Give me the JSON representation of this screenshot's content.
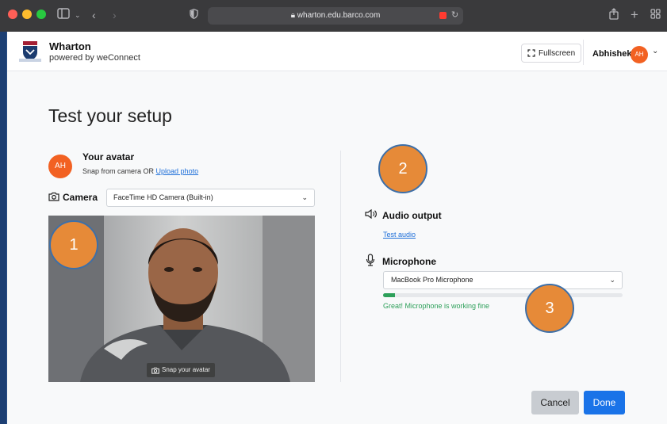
{
  "browser": {
    "url": "wharton.edu.barco.com",
    "icons": [
      "sidebar-icon",
      "back-icon",
      "forward-icon",
      "shield-icon",
      "lock-icon",
      "camera-record-icon",
      "reload-icon",
      "share-icon",
      "new-tab-icon",
      "tab-overview-icon"
    ]
  },
  "header": {
    "brand_name": "Wharton",
    "brand_sub": "powered by weConnect",
    "fullscreen_label": "Fullscreen",
    "user_name": "Abhishek",
    "user_initials": "AH"
  },
  "main": {
    "title": "Test your setup",
    "avatar": {
      "initials": "AH",
      "title": "Your avatar",
      "sub_prefix": "Snap from camera OR ",
      "upload_link": "Upload photo"
    },
    "camera": {
      "label": "Camera",
      "selected": "FaceTime HD Camera (Built-in)",
      "snap_button": "Snap your avatar"
    },
    "audio": {
      "label": "Audio output",
      "test_link": "Test audio"
    },
    "microphone": {
      "label": "Microphone",
      "selected": "MacBook Pro Microphone",
      "level_fraction": 0.05,
      "status": "Great! Microphone is working fine"
    },
    "buttons": {
      "cancel": "Cancel",
      "done": "Done"
    }
  },
  "annotations": [
    "1",
    "2",
    "3"
  ],
  "colors": {
    "accent": "#1a73e8",
    "avatar": "#f26122",
    "success": "#2ea05a",
    "marker": "#e68a38"
  }
}
